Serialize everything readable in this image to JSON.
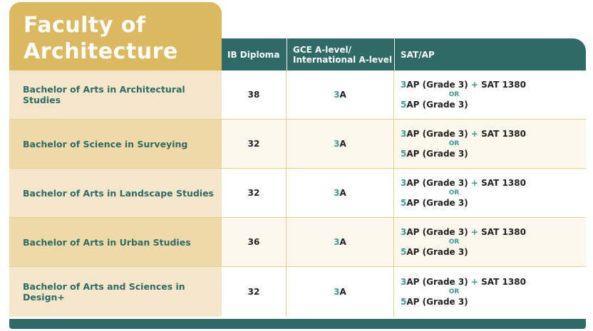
{
  "title": "Faculty of\nArchitecture",
  "columns": {
    "ib": "IB Diploma",
    "gce": "GCE A-level/\nInternational A-level",
    "sat": "SAT/AP"
  },
  "or_label": "OR",
  "rows": [
    {
      "programme": "Bachelor of Arts in Architectural Studies",
      "ib": "38",
      "gce_count": "3",
      "gce_grade": "A",
      "sat_opt1_count": "3",
      "sat_opt1_text": "AP (Grade 3)",
      "sat_plus": "+",
      "sat_opt1_sat": "SAT 1380",
      "sat_opt2_count": "5",
      "sat_opt2_text": "AP (Grade 3)"
    },
    {
      "programme": "Bachelor of Science in Surveying",
      "ib": "32",
      "gce_count": "3",
      "gce_grade": "A",
      "sat_opt1_count": "3",
      "sat_opt1_text": "AP (Grade 3)",
      "sat_plus": "+",
      "sat_opt1_sat": "SAT 1380",
      "sat_opt2_count": "5",
      "sat_opt2_text": "AP (Grade 3)"
    },
    {
      "programme": "Bachelor of Arts in Landscape Studies",
      "ib": "32",
      "gce_count": "3",
      "gce_grade": "A",
      "sat_opt1_count": "3",
      "sat_opt1_text": "AP (Grade 3)",
      "sat_plus": "+",
      "sat_opt1_sat": "SAT 1380",
      "sat_opt2_count": "5",
      "sat_opt2_text": "AP (Grade 3)"
    },
    {
      "programme": "Bachelor of Arts in Urban Studies",
      "ib": "36",
      "gce_count": "3",
      "gce_grade": "A",
      "sat_opt1_count": "3",
      "sat_opt1_text": "AP (Grade 3)",
      "sat_plus": "+",
      "sat_opt1_sat": "SAT 1380",
      "sat_opt2_count": "5",
      "sat_opt2_text": "AP (Grade 3)"
    },
    {
      "programme": "Bachelor of Arts and Sciences in Design+",
      "ib": "32",
      "gce_count": "3",
      "gce_grade": "A",
      "sat_opt1_count": "3",
      "sat_opt1_text": "AP (Grade 3)",
      "sat_plus": "+",
      "sat_opt1_sat": "SAT 1380",
      "sat_opt2_count": "5",
      "sat_opt2_text": "AP (Grade 3)"
    }
  ]
}
